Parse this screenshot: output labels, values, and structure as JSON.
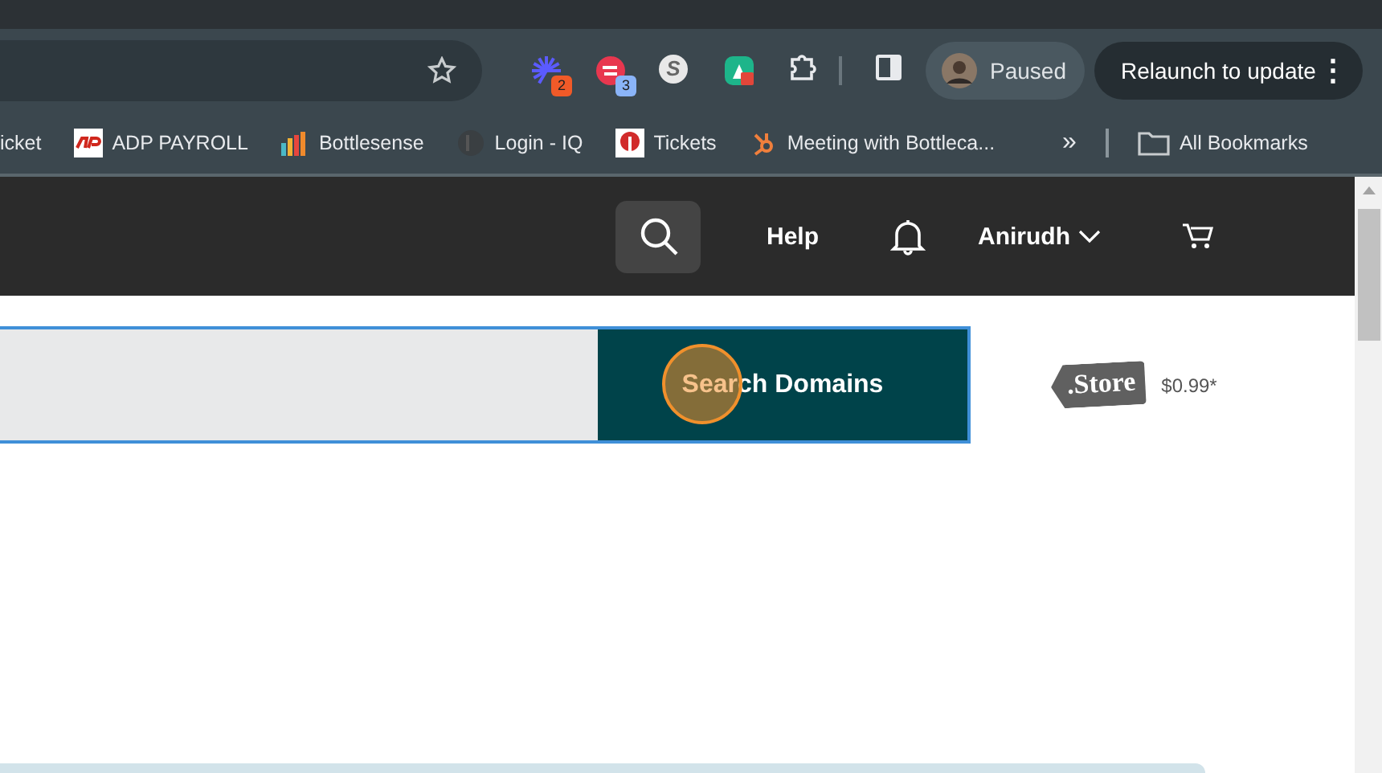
{
  "toolbar": {
    "extensions": [
      {
        "kind": "burst",
        "badge": "2",
        "color": "#f05a28"
      },
      {
        "kind": "lines",
        "badge": "3",
        "color": "#8ab4f8"
      },
      {
        "kind": "letter",
        "glyph": "S"
      },
      {
        "kind": "lock"
      }
    ],
    "profile": {
      "label": "Paused"
    },
    "relaunch": {
      "label": "Relaunch to update",
      "menu": "⋮"
    }
  },
  "bookmarks": {
    "items": [
      {
        "kind": "none",
        "label": "icket"
      },
      {
        "kind": "adp",
        "label": "ADP PAYROLL"
      },
      {
        "kind": "bars",
        "label": "Bottlesense"
      },
      {
        "kind": "iq",
        "label": "Login - IQ"
      },
      {
        "kind": "ticket",
        "label": "Tickets"
      },
      {
        "kind": "hub",
        "label": "Meeting with Bottleca..."
      }
    ],
    "more": "»",
    "all": "All Bookmarks"
  },
  "header": {
    "help": "Help",
    "user": "Anirudh"
  },
  "domain_search": {
    "button": "Search Domains",
    "tld": {
      "logo": ".Store",
      "price": "$0.99*"
    }
  }
}
